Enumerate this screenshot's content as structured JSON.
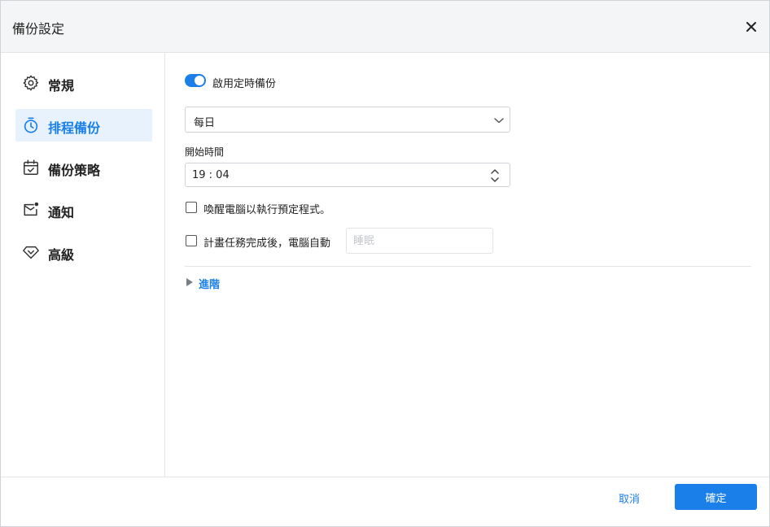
{
  "dialog": {
    "title": "備份設定",
    "close_icon": "close-icon"
  },
  "sidebar": {
    "items": [
      {
        "label": "常規",
        "icon": "gear-icon",
        "active": false
      },
      {
        "label": "排程備份",
        "icon": "timer-icon",
        "active": true
      },
      {
        "label": "備份策略",
        "icon": "calendar-check-icon",
        "active": false
      },
      {
        "label": "通知",
        "icon": "mail-notification-icon",
        "active": false
      },
      {
        "label": "高級",
        "icon": "diamond-icon",
        "active": false
      }
    ]
  },
  "schedule": {
    "enable_label": "啟用定時備份",
    "enabled": true,
    "frequency": {
      "selected": "每日"
    },
    "start_time": {
      "label": "開始時間",
      "value": "19 : 04"
    },
    "wake_pc": {
      "label": "喚醒電腦以執行預定程式。",
      "checked": false
    },
    "after_task": {
      "label": "計畫任務完成後，電腦自動",
      "checked": false,
      "placeholder": "睡眠"
    },
    "advanced_label": "進階"
  },
  "footer": {
    "cancel_label": "取消",
    "ok_label": "確定"
  },
  "colors": {
    "accent": "#1a7fe8",
    "active_bg": "#e8f2fd",
    "border": "#cfd3d8"
  }
}
